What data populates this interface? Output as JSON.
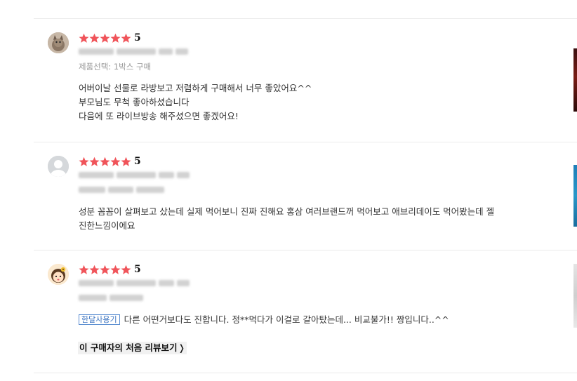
{
  "reviews": [
    {
      "avatar": "cat-photo",
      "stars": 5,
      "score": "5",
      "option": "제품선택: 1박스 구매",
      "badge": "",
      "content": [
        "어버이날 선물로 라방보고 저렴하게 구매해서 너무 좋았어요^^",
        "부모님도 무척 좋아하셨습니다",
        "다음에 또 라이브방송 해주셨으면 좋겠어요!"
      ]
    },
    {
      "avatar": "default-user",
      "stars": 5,
      "score": "5",
      "option": "",
      "badge": "",
      "content": [
        "성분 꼼꼼이 살펴보고 샀는데 실제 먹어보니 진짜 진해요 홍삼 여러브랜드꺼 먹어보고 애브리데이도 먹어봤는데 젤",
        "진한느낌이에요"
      ]
    },
    {
      "avatar": "cartoon-girl",
      "stars": 5,
      "score": "5",
      "option": "",
      "badge": "한달사용기",
      "content": [
        "다른 어떤거보다도 진합니다. 정**먹다가 이걸로 갈아탔는데... 비교불가!! 짱입니다..^^"
      ],
      "first_review_link": "이 구매자의 처음 리뷰보기"
    }
  ],
  "colors": {
    "star": "#f0545a",
    "divider": "#ebebeb",
    "badge_border": "#5b8ed1"
  }
}
